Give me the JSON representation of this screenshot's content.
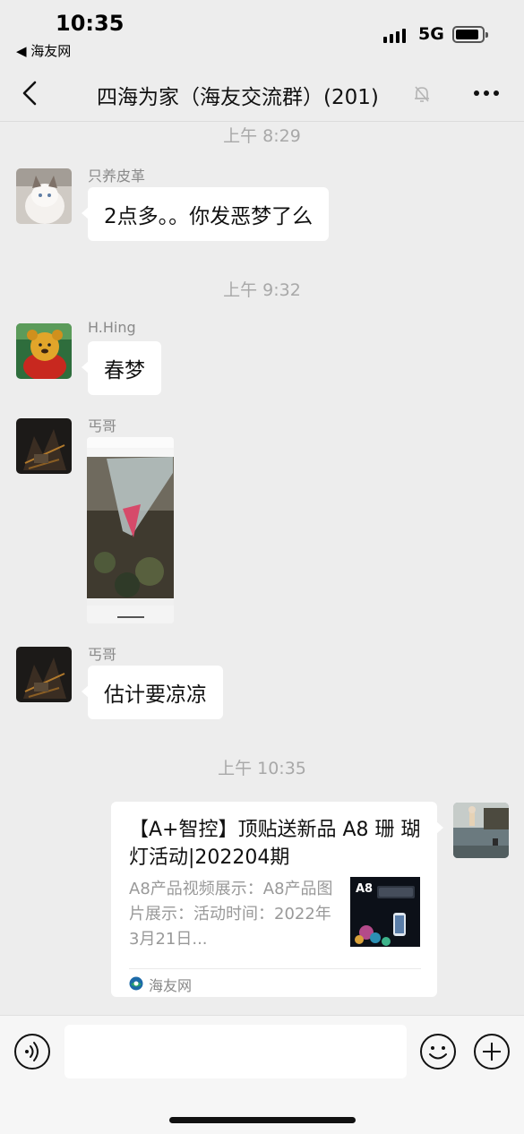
{
  "status_bar": {
    "time": "10:35",
    "back_app": "◀ 海友网",
    "network": "5G"
  },
  "nav": {
    "title": "四海为家（海友交流群）(201)"
  },
  "messages": [
    {
      "time_sep": "上午 8:29",
      "sender": "只养皮革",
      "text": "2点多。。你发恶梦了么"
    },
    {
      "time_sep": "上午 9:32",
      "sender": "H.Hing",
      "text": "春梦"
    },
    {
      "sender": "丐哥",
      "type": "image"
    },
    {
      "sender": "丐哥",
      "text": "估计要凉凉"
    },
    {
      "time_sep": "上午 10:35"
    }
  ],
  "link_card": {
    "title": "【A+智控】顶贴送新品 A8 珊 瑚灯活动|202204期",
    "description": "A8产品视频展示：A8产品图片展示：活动时间：2022年3月21日...",
    "thumb_label": "A8",
    "source": "海友网"
  },
  "input": {
    "placeholder": ""
  },
  "colors": {
    "background": "#ededed",
    "bubble": "#ffffff",
    "secondary_text": "#a8a8a8"
  }
}
